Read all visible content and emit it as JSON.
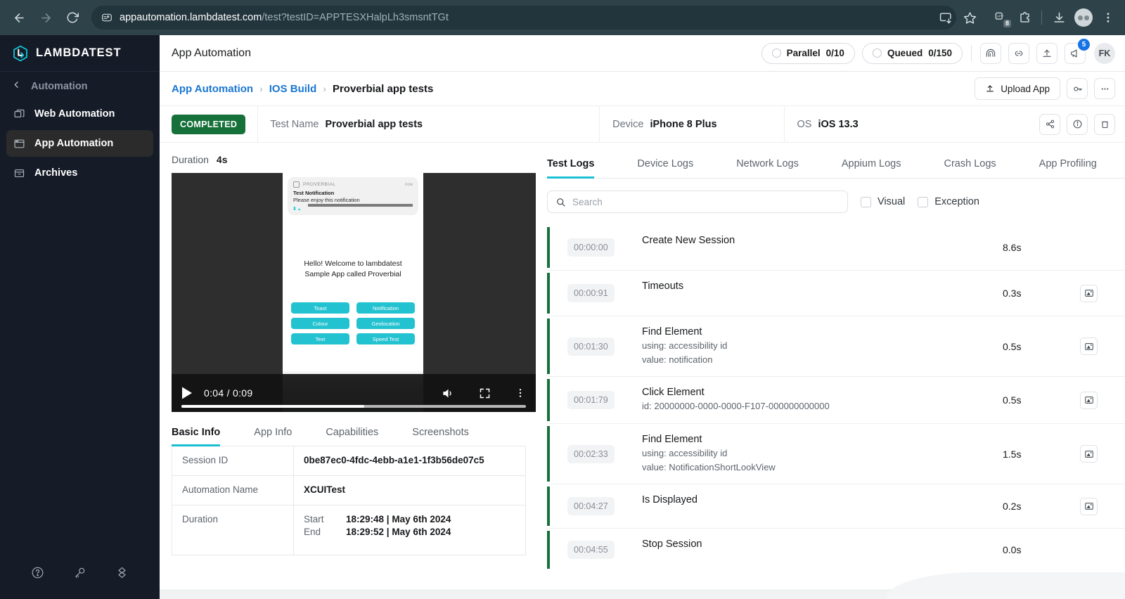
{
  "browser": {
    "back_icon": "back-arrow-icon",
    "forward_icon": "forward-arrow-icon",
    "reload_icon": "reload-icon",
    "site_info_icon": "site-settings-icon",
    "url_host": "appautomation.lambdatest.com",
    "url_path": "/test?testID=APPTESXHalpLh3smsntTGt",
    "install_icon": "install-app-icon",
    "bookmark_icon": "star-icon",
    "extension_badge": "8",
    "extensions_icon": "extensions-puzzle-icon",
    "downloads_icon": "download-icon",
    "profile_icon": "profile-avatar-icon",
    "menu_icon": "kebab-menu-icon"
  },
  "sidebar": {
    "brand": "LAMBDATEST",
    "back_label": "Automation",
    "items": [
      {
        "label": "Web Automation",
        "icon": "windows-stack-icon",
        "active": false
      },
      {
        "label": "App Automation",
        "icon": "app-window-icon",
        "active": true
      },
      {
        "label": "Archives",
        "icon": "archive-box-icon",
        "active": false
      }
    ],
    "bottom_icons": [
      "help-circle-icon",
      "key-icon",
      "integrations-icon"
    ]
  },
  "topbar": {
    "title": "App Automation",
    "parallel_label": "Parallel",
    "parallel_value": "0/10",
    "queued_label": "Queued",
    "queued_value": "0/150",
    "icons": [
      "tunnel-icon",
      "link-icon",
      "upload-icon",
      "announcement-icon"
    ],
    "notification_count": "5",
    "avatar_initials": "FK"
  },
  "breadcrumb": {
    "items": [
      "App Automation",
      "IOS Build",
      "Proverbial app tests"
    ],
    "separator": ">",
    "upload_app_label": "Upload App",
    "key_icon": "key-icon",
    "more_icon": "ellipsis-icon"
  },
  "status": {
    "badge": "COMPLETED",
    "test_name_label": "Test Name",
    "test_name_value": "Proverbial app tests",
    "device_label": "Device",
    "device_value": "iPhone 8 Plus",
    "os_label": "OS",
    "os_value": "iOS 13.3",
    "actions": [
      "share-icon",
      "info-icon",
      "delete-icon"
    ]
  },
  "video": {
    "duration_label": "Duration",
    "duration_value": "4s",
    "current_time": "0:04",
    "total_time": "0:09",
    "time_display": "0:04 / 0:09",
    "play_icon": "play-icon",
    "volume_icon": "volume-icon",
    "fullscreen_icon": "fullscreen-icon",
    "more_icon": "kebab-menu-icon",
    "progress_percent": 53,
    "phone_screen": {
      "notification_app": "PROVERBIAL",
      "notification_time": "now",
      "notification_title": "Test Notification",
      "notification_body": "Please enjoy this notification",
      "welcome_text": "Hello! Welcome to lambdatest Sample App called Proverbial",
      "buttons": [
        "Toast",
        "Notification",
        "Colour",
        "Geolocation",
        "Text",
        "Speed Test"
      ],
      "accent_color": "#18bfcf"
    }
  },
  "left_tabs": [
    {
      "label": "Basic Info",
      "active": true
    },
    {
      "label": "App Info",
      "active": false
    },
    {
      "label": "Capabilities",
      "active": false
    },
    {
      "label": "Screenshots",
      "active": false
    }
  ],
  "basic_info": {
    "rows": [
      {
        "key": "Session ID",
        "value": "0be87ec0-4fdc-4ebb-a1e1-1f3b56de07c5"
      },
      {
        "key": "Automation Name",
        "value": "XCUITest"
      }
    ],
    "duration_key": "Duration",
    "start_label": "Start",
    "start_value": "18:29:48 | May 6th 2024",
    "end_label": "End",
    "end_value": "18:29:52 | May 6th 2024"
  },
  "right_tabs": [
    {
      "label": "Test Logs",
      "active": true
    },
    {
      "label": "Device Logs",
      "active": false
    },
    {
      "label": "Network Logs",
      "active": false
    },
    {
      "label": "Appium Logs",
      "active": false
    },
    {
      "label": "Crash Logs",
      "active": false
    },
    {
      "label": "App Profiling",
      "active": false
    }
  ],
  "filters": {
    "search_placeholder": "Search",
    "search_value": "",
    "search_icon": "search-icon",
    "visual_label": "Visual",
    "exception_label": "Exception"
  },
  "logs": [
    {
      "timestamp": "00:00:00",
      "name": "Create New Session",
      "sub": "",
      "duration": "8.6s",
      "screenshot": false
    },
    {
      "timestamp": "00:00:91",
      "name": "Timeouts",
      "sub": "",
      "duration": "0.3s",
      "screenshot": true
    },
    {
      "timestamp": "00:01:30",
      "name": "Find Element",
      "sub": "using: accessibility id\nvalue: notification",
      "duration": "0.5s",
      "screenshot": true
    },
    {
      "timestamp": "00:01:79",
      "name": "Click Element",
      "sub": "id: 20000000-0000-0000-F107-000000000000",
      "duration": "0.5s",
      "screenshot": true
    },
    {
      "timestamp": "00:02:33",
      "name": "Find Element",
      "sub": "using: accessibility id\nvalue: NotificationShortLookView",
      "duration": "1.5s",
      "screenshot": true
    },
    {
      "timestamp": "00:04:27",
      "name": "Is Displayed",
      "sub": "",
      "duration": "0.2s",
      "screenshot": true
    },
    {
      "timestamp": "00:04:55",
      "name": "Stop Session",
      "sub": "",
      "duration": "0.0s",
      "screenshot": false
    }
  ],
  "colors": {
    "brand_teal": "#1bbfd4",
    "status_green": "#16703a",
    "link_blue": "#1976d2",
    "sidebar_bg": "#151b27",
    "chrome_bg": "#2e4249"
  }
}
